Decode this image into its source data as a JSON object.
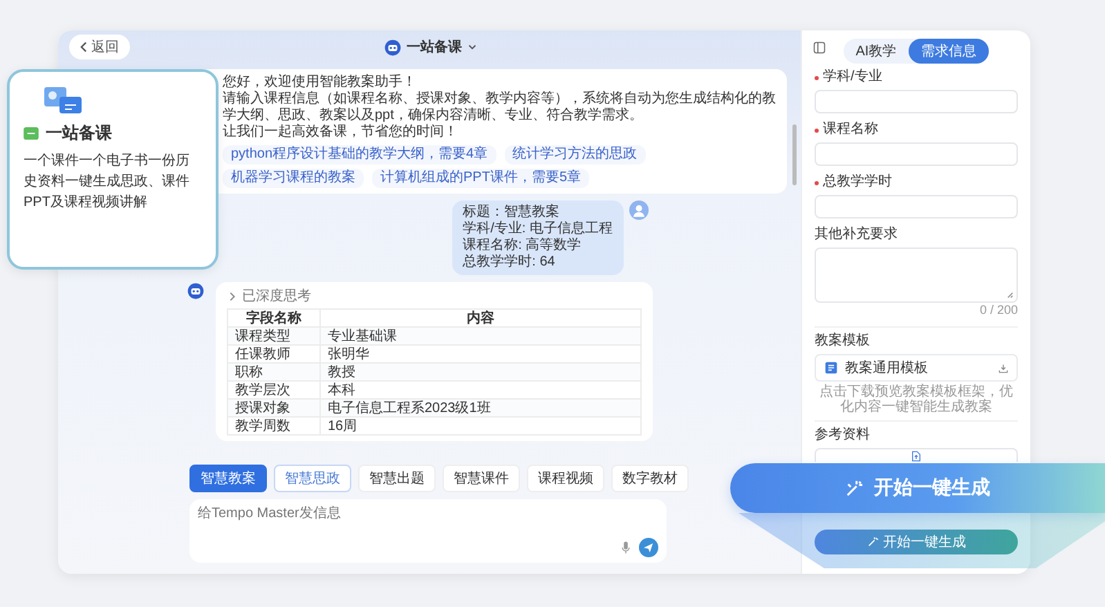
{
  "header": {
    "back": "返回",
    "title": "一站备课"
  },
  "welcome": {
    "lines": [
      "您好，欢迎使用智能教案助手！",
      "请输入课程信息（如课程名称、授课对象、教学内容等），系统将自动为您生成结构化的教学大纲、思政、教案以及ppt，确保内容清晰、专业、符合教学需求。",
      "让我们一起高效备课，节省您的时间！"
    ],
    "suggestions": [
      "python程序设计基础的教学大纲，需要4章",
      "统计学习方法的思政",
      "机器学习课程的教案",
      "计算机组成的PPT课件，需要5章"
    ]
  },
  "user_message": {
    "lines": [
      "标题：智慧教案",
      "学科/专业: 电子信息工程",
      "课程名称: 高等数学",
      "总教学学时: 64"
    ]
  },
  "answer": {
    "thinking": "已深度思考",
    "expanded": false,
    "table": {
      "columns": [
        "字段名称",
        "内容"
      ],
      "rows": [
        [
          "课程类型",
          "专业基础课"
        ],
        [
          "任课教师",
          "张明华"
        ],
        [
          "职称",
          "教授"
        ],
        [
          "教学层次",
          "本科"
        ],
        [
          "授课对象",
          "电子信息工程系2023级1班"
        ],
        [
          "教学周数",
          "16周"
        ]
      ]
    }
  },
  "tools": [
    {
      "label": "智慧教案",
      "selected": true,
      "focused": false
    },
    {
      "label": "智慧思政",
      "selected": false,
      "focused": true
    },
    {
      "label": "智慧出题",
      "selected": false,
      "focused": false
    },
    {
      "label": "智慧课件",
      "selected": false,
      "focused": false
    },
    {
      "label": "课程视频",
      "selected": false,
      "focused": false
    },
    {
      "label": "数字教材",
      "selected": false,
      "focused": false
    }
  ],
  "composer": {
    "placeholder": "给Tempo Master发信息"
  },
  "panel": {
    "tabs": [
      {
        "label": "AI教学",
        "selected": false
      },
      {
        "label": "需求信息",
        "selected": true
      }
    ],
    "fields": [
      {
        "kind": "input",
        "label": "学科/专业",
        "required": true
      },
      {
        "kind": "input",
        "label": "课程名称",
        "required": true
      },
      {
        "kind": "input",
        "label": "总教学学时",
        "required": true
      },
      {
        "kind": "textarea",
        "label": "其他补充要求",
        "required": false,
        "counter": "0 / 200"
      }
    ],
    "template": {
      "heading": "教案模板",
      "file": "教案通用模板",
      "hint": "点击下载预览教案模板框架，优化内容一键智能生成教案"
    },
    "reference": {
      "heading": "参考资料"
    },
    "generate_button": "开始一键生成"
  },
  "feature_card": {
    "title": "一站备课",
    "description": "一个课件一个电子书一份历史资料一键生成思政、课件PPT及课程视频讲解"
  },
  "cta_button": "开始一键生成"
}
